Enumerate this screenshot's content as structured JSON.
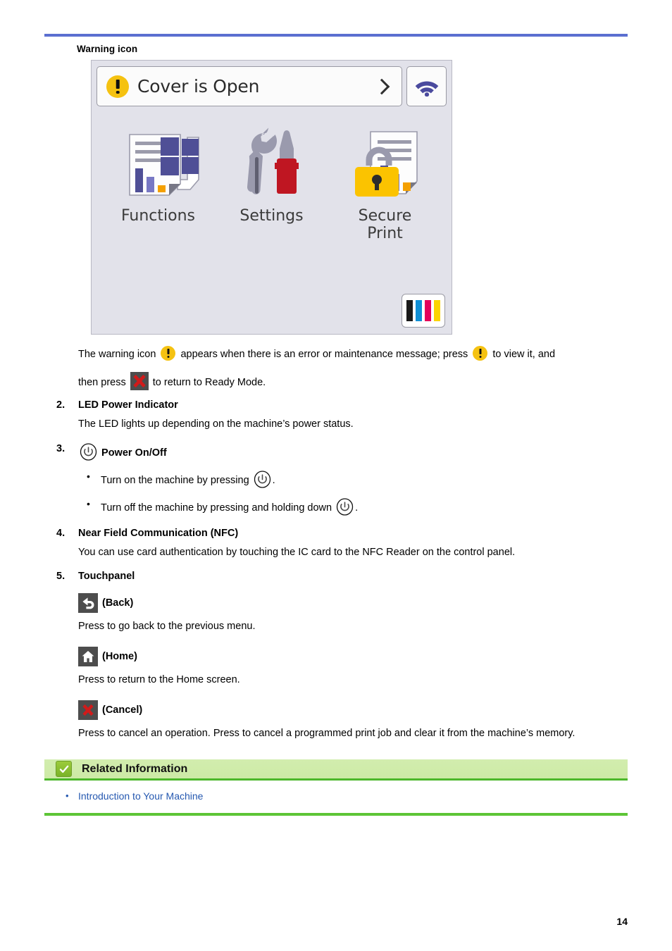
{
  "page": {
    "number": "14",
    "top_rule_color": "#5b6fd0"
  },
  "section": {
    "warning_icon_heading": "Warning icon"
  },
  "lcd": {
    "status_message": "Cover is Open",
    "chevron_icon": "chevron-right-icon",
    "warning_icon": "warning-exclamation-icon",
    "wifi_icon": "wifi-icon",
    "tiles": [
      {
        "label": "Functions",
        "icon": "functions-document-icon"
      },
      {
        "label": "Settings",
        "icon": "wrench-screwdriver-icon"
      },
      {
        "label": "Secure\nPrint",
        "label_line1": "Secure",
        "label_line2": "Print",
        "icon": "lock-document-icon"
      }
    ],
    "toner": {
      "name": "toner-level-indicator",
      "colors": [
        "#1a1a1a",
        "#0f8fd6",
        "#e4005a",
        "#fbd400"
      ]
    }
  },
  "body": {
    "warning_para_1": "The warning icon",
    "warning_para_2": "appears when there is an error or maintenance message; press",
    "warning_para_3": "to view it, and",
    "warning_para_4": "then press",
    "warning_para_5": "to return to Ready Mode."
  },
  "items": [
    {
      "number": "2.",
      "title": "LED Power Indicator",
      "paragraph": "The LED lights up depending on the machine’s power status."
    },
    {
      "number": "3.",
      "title": "Power On/Off",
      "icon": "power-icon",
      "bullets": [
        {
          "text_before": "Turn on the machine by pressing",
          "icon": "power-icon",
          "text_after": "."
        },
        {
          "text_before": "Turn off the machine by pressing and holding down",
          "icon": "power-icon",
          "text_after": "."
        }
      ]
    },
    {
      "number": "4.",
      "title": "Near Field Communication (NFC)",
      "paragraph": "You can use card authentication by touching the IC card to the NFC Reader on the control panel."
    },
    {
      "number": "5.",
      "title": "Touchpanel"
    }
  ],
  "touchpanel": {
    "buttons": [
      {
        "icon": "back-arrow-icon",
        "label": "(Back)",
        "description": "Press to go back to the previous menu."
      },
      {
        "icon": "home-icon",
        "label": "(Home)",
        "description": "Press to return to the Home screen."
      },
      {
        "icon": "cancel-x-icon",
        "label": "(Cancel)",
        "description": "Press to cancel an operation. Press to cancel a programmed print job and clear it from the machine’s memory."
      }
    ]
  },
  "related_information": {
    "title": "Related Information",
    "check_icon": "check-icon",
    "links": [
      "Introduction to Your Machine"
    ],
    "bar_color": "#cdeaa6",
    "rule_color": "#5dc536"
  }
}
